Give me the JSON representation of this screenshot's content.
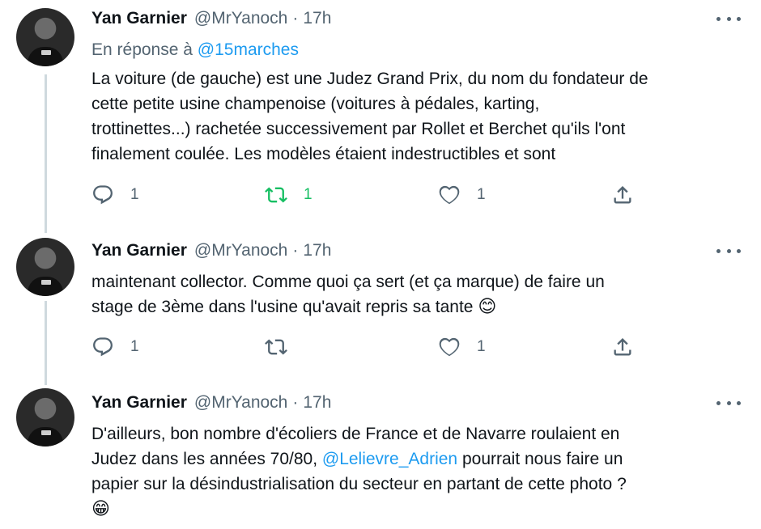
{
  "tweets": [
    {
      "author": {
        "name": "Yan Garnier",
        "handle": "@MrYanoch",
        "time": "17h"
      },
      "reply": {
        "prefix": "En réponse à",
        "mention": "@15marches"
      },
      "lines": [
        "La voiture (de gauche) est une Judez Grand Prix, du nom du fondateur de",
        "cette petite usine champenoise (voitures à pédales, karting,",
        "trottinettes...) rachetée successivement par Rollet et Berchet qu'ils l'ont",
        "finalement coulée. Les modèles étaient indestructibles et sont"
      ],
      "actions": {
        "replies": "1",
        "retweets": "1",
        "likes": "1"
      },
      "retweeted": true,
      "icons": [
        "reply-icon",
        "retweet-icon",
        "like-icon",
        "share-icon",
        "more-icon"
      ]
    },
    {
      "author": {
        "name": "Yan Garnier",
        "handle": "@MrYanoch",
        "time": "17h"
      },
      "lines": [
        "maintenant collector. Comme quoi ça sert (et ça marque) de faire un",
        "stage de 3ème dans l'usine qu'avait repris sa tante"
      ],
      "emoji": "😊",
      "actions": {
        "replies": "1",
        "retweets": "",
        "likes": "1"
      },
      "retweeted": false
    },
    {
      "author": {
        "name": "Yan Garnier",
        "handle": "@MrYanoch",
        "time": "17h"
      },
      "lines": [
        "D'ailleurs, bon nombre d'écoliers de France et de Navarre roulaient en"
      ],
      "line2_pre": "Judez dans les années 70/80, ",
      "line2_mention": "@Lelievre_Adrien",
      "line2_post": " pourrait nous faire un",
      "line3": "papier sur la désindustrialisation du secteur en partant de cette photo ?",
      "emoji": "😁"
    }
  ],
  "colors": {
    "accent": "#1d9bf0",
    "retweet_active": "#17bf63",
    "muted": "#536471",
    "thread_line": "#cfd9de"
  }
}
